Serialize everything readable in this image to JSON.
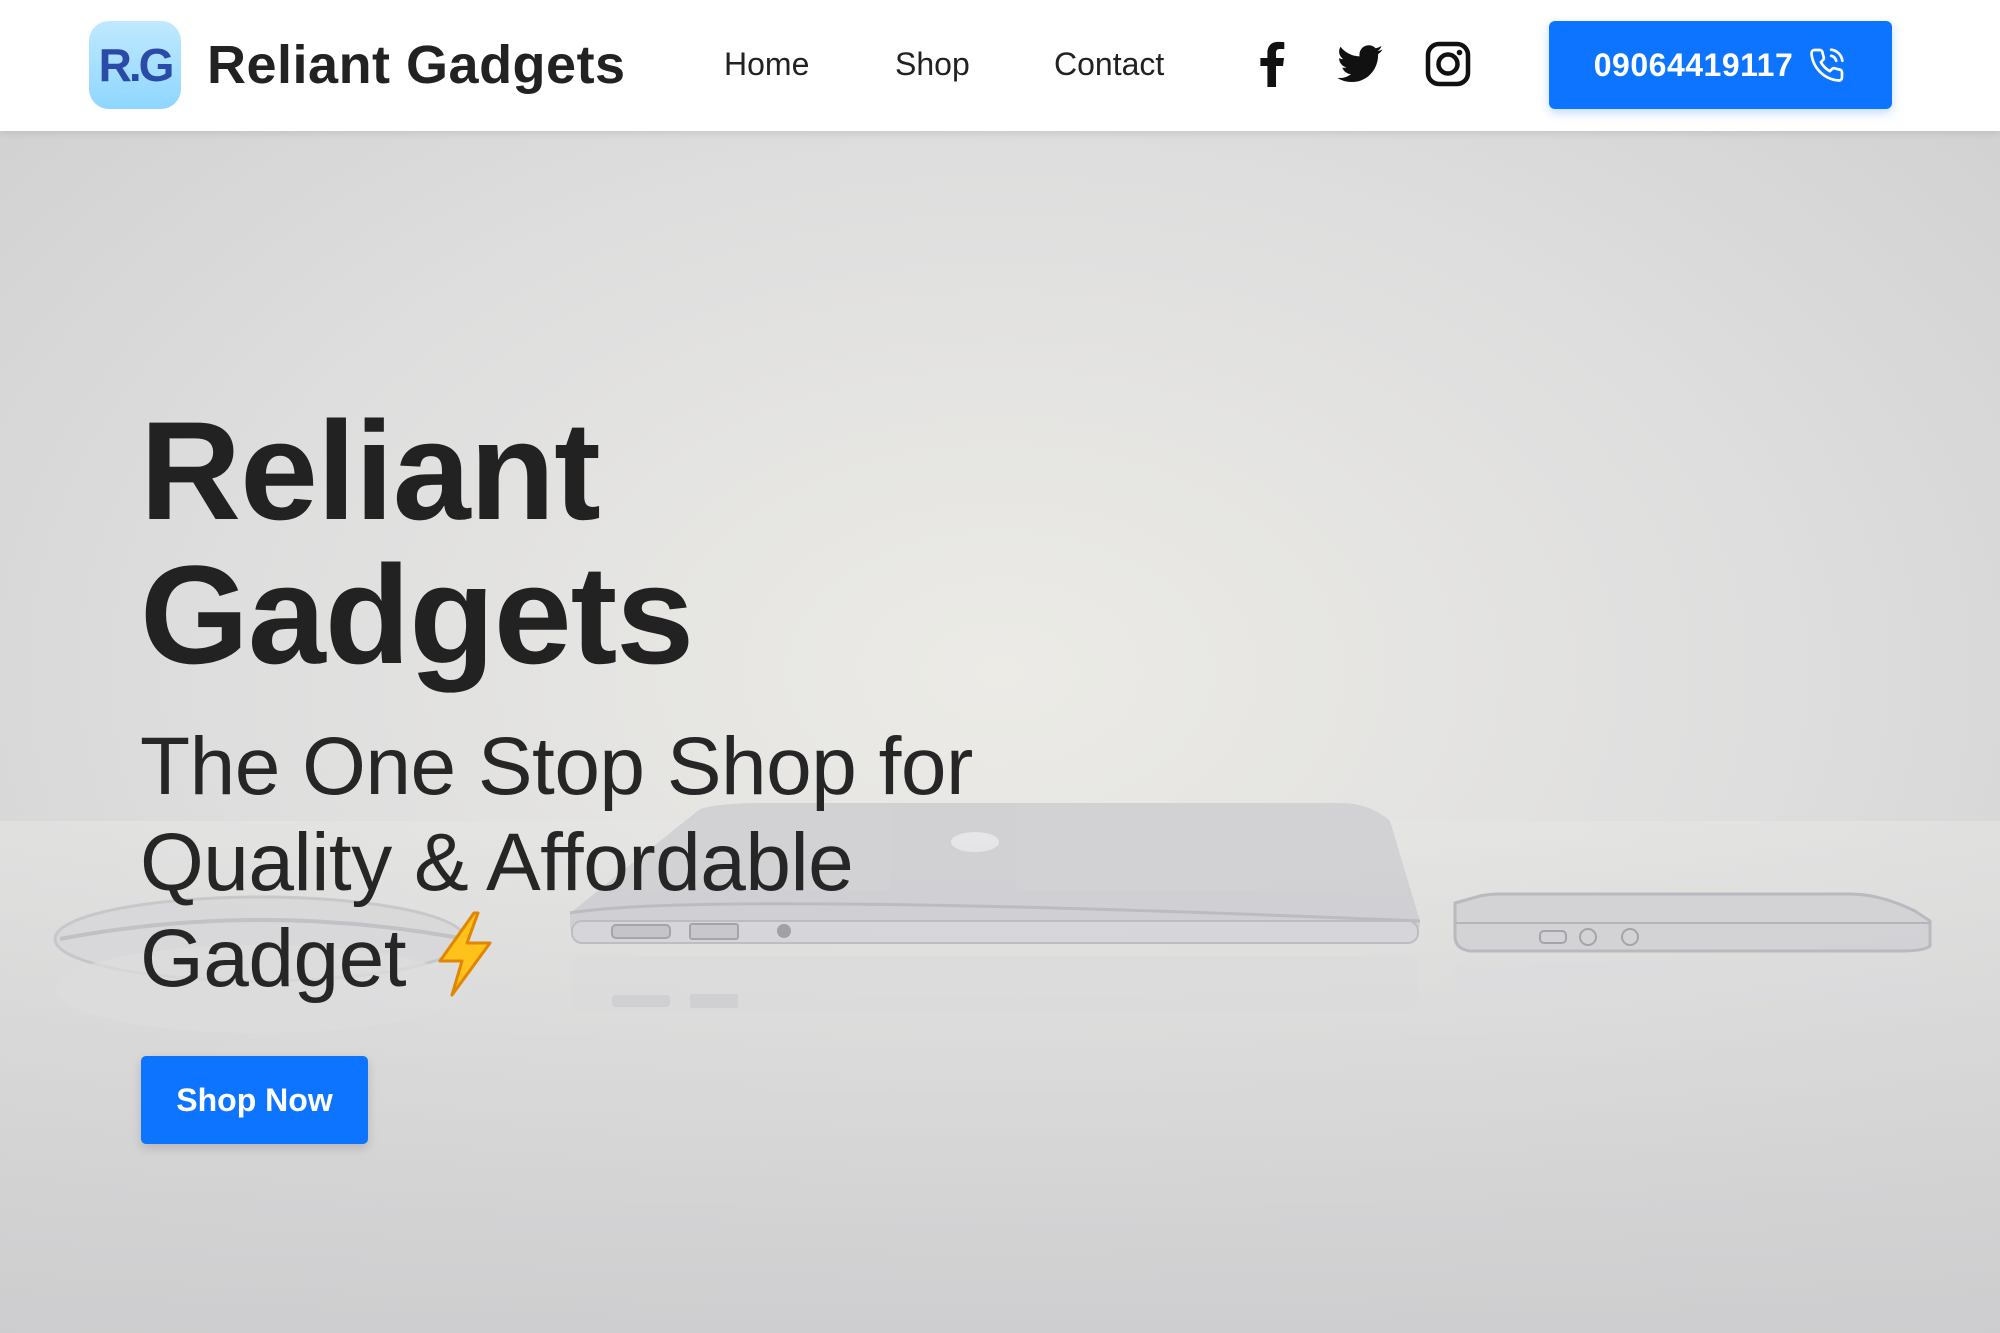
{
  "brand": {
    "logo_text": "R.G",
    "name": "Reliant Gadgets"
  },
  "nav": {
    "links": [
      {
        "label": "Home"
      },
      {
        "label": "Shop"
      },
      {
        "label": "Contact"
      }
    ],
    "social_icons": [
      "facebook-icon",
      "twitter-icon",
      "instagram-icon"
    ]
  },
  "phone": {
    "number": "09064419117",
    "icon": "phone-icon"
  },
  "hero": {
    "title_line1": "Reliant",
    "title_line2": "Gadgets",
    "subtitle_line1": "The One Stop Shop for",
    "subtitle_line2": "Quality & Affordable",
    "subtitle_line3": "Gadget",
    "emoji_icon": "lightning-bolt-icon",
    "cta_label": "Shop Now"
  },
  "colors": {
    "accent": "#0d74ff",
    "text": "#222222",
    "navbar_bg": "#ffffff",
    "logo_bg": "#a8e0ff",
    "logo_text": "#2a4aa8"
  }
}
